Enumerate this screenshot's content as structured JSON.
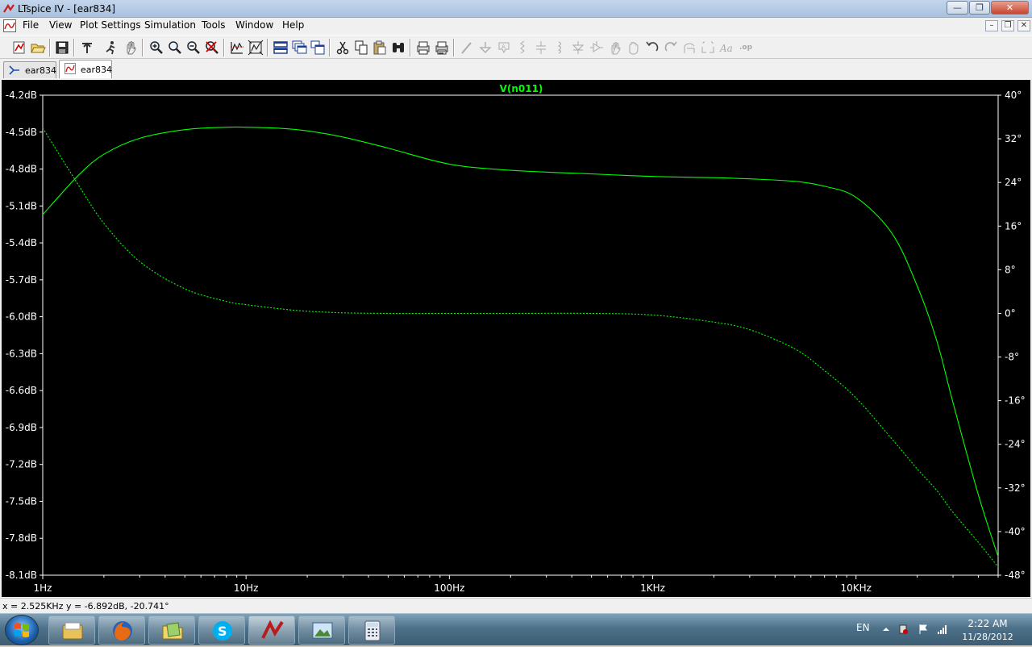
{
  "window": {
    "title": "LTspice IV - [ear834]",
    "controls": {
      "minimize": "—",
      "restore": "❐",
      "close": "✕"
    }
  },
  "menubar": {
    "items": [
      {
        "label": "File"
      },
      {
        "label": "View"
      },
      {
        "label": "Plot Settings"
      },
      {
        "label": "Simulation"
      },
      {
        "label": "Tools"
      },
      {
        "label": "Window"
      },
      {
        "label": "Help"
      }
    ],
    "mdi_controls": {
      "minimize": "–",
      "restore": "❐",
      "close": "✕"
    }
  },
  "toolbar": {
    "icons": [
      "new-schematic-icon",
      "open-icon",
      "save-icon",
      "control-panel-icon",
      "run-icon",
      "halt-icon",
      "zoom-in-icon",
      "zoom-area-icon",
      "zoom-out-icon",
      "zoom-cancel-icon",
      "autorange-icon",
      "zoom-fit-icon",
      "tile-horizontal-icon",
      "cascade-icon",
      "tile-vertical-icon",
      "cut-icon",
      "copy-icon",
      "paste-icon",
      "find-icon",
      "print-preview-icon",
      "print-icon",
      "wire-icon",
      "ground-icon",
      "label-icon",
      "resistor-icon",
      "capacitor-icon",
      "inductor-icon",
      "diode-icon",
      "component-icon",
      "move-icon",
      "drag-icon",
      "undo-icon",
      "redo-icon",
      "rotate-icon",
      "mirror-icon",
      "text-icon",
      "spice-directive-icon"
    ]
  },
  "tabs": [
    {
      "label": "ear834",
      "kind": "schematic",
      "active": false
    },
    {
      "label": "ear834",
      "kind": "waveform",
      "active": true
    }
  ],
  "plot": {
    "trace_label": "V(n011)",
    "colors": {
      "background": "#000000",
      "trace": "#00ff00",
      "axis": "#ffffff"
    },
    "left_ticks": [
      "-4.2dB",
      "-4.5dB",
      "-4.8dB",
      "-5.1dB",
      "-5.4dB",
      "-5.7dB",
      "-6.0dB",
      "-6.3dB",
      "-6.6dB",
      "-6.9dB",
      "-7.2dB",
      "-7.5dB",
      "-7.8dB",
      "-8.1dB"
    ],
    "right_ticks": [
      "40°",
      "32°",
      "24°",
      "16°",
      "8°",
      "0°",
      "-8°",
      "-16°",
      "-24°",
      "-32°",
      "-40°",
      "-48°"
    ],
    "x_ticks": [
      "1Hz",
      "10Hz",
      "100Hz",
      "1KHz",
      "10KHz"
    ]
  },
  "chart_data": {
    "type": "line",
    "title": "V(n011)",
    "xlabel": "",
    "ylabel": "",
    "x_scale": "log",
    "xlim": [
      1,
      50000
    ],
    "ylim": [
      -8.1,
      -4.2
    ],
    "y2lim": [
      -48,
      40
    ],
    "grid": false,
    "series": [
      {
        "name": "V(n011)",
        "style": "solid",
        "axis": "left",
        "unit": "dB",
        "x": [
          1,
          1.5,
          2,
          3,
          5,
          8,
          10,
          15,
          20,
          30,
          50,
          100,
          200,
          500,
          1000,
          2000,
          3000,
          5000,
          7000,
          10000,
          15000,
          20000,
          25000,
          30000,
          40000,
          50000
        ],
        "values": [
          -5.17,
          -4.85,
          -4.68,
          -4.55,
          -4.48,
          -4.46,
          -4.46,
          -4.47,
          -4.49,
          -4.54,
          -4.63,
          -4.76,
          -4.81,
          -4.84,
          -4.86,
          -4.87,
          -4.88,
          -4.9,
          -4.94,
          -5.03,
          -5.32,
          -5.75,
          -6.2,
          -6.7,
          -7.45,
          -7.95
        ]
      },
      {
        "name": "V(n011)",
        "style": "dashed",
        "axis": "right",
        "unit": "°",
        "x": [
          1,
          1.5,
          2,
          3,
          5,
          8,
          10,
          15,
          20,
          30,
          50,
          100,
          200,
          500,
          1000,
          2000,
          3000,
          5000,
          7000,
          10000,
          15000,
          20000,
          25000,
          30000,
          40000,
          50000
        ],
        "values": [
          34,
          23.5,
          16.5,
          9.5,
          4.5,
          2.2,
          1.6,
          0.8,
          0.4,
          0.1,
          0,
          0,
          0,
          0,
          -0.3,
          -1.6,
          -3,
          -6.5,
          -10.5,
          -15.5,
          -23,
          -28.5,
          -32.5,
          -36.5,
          -42,
          -46.5
        ]
      }
    ]
  },
  "status": {
    "readout": "x = 2.525KHz   y = -6.892dB, -20.741°"
  },
  "taskbar": {
    "apps": [
      {
        "name": "windows-explorer-icon"
      },
      {
        "name": "firefox-icon"
      },
      {
        "name": "folder-icon"
      },
      {
        "name": "skype-icon"
      },
      {
        "name": "ltspice-icon",
        "active": true
      },
      {
        "name": "picture-viewer-icon"
      },
      {
        "name": "calculator-icon"
      }
    ],
    "language": "EN",
    "time": "2:22 AM",
    "date": "11/28/2012"
  }
}
